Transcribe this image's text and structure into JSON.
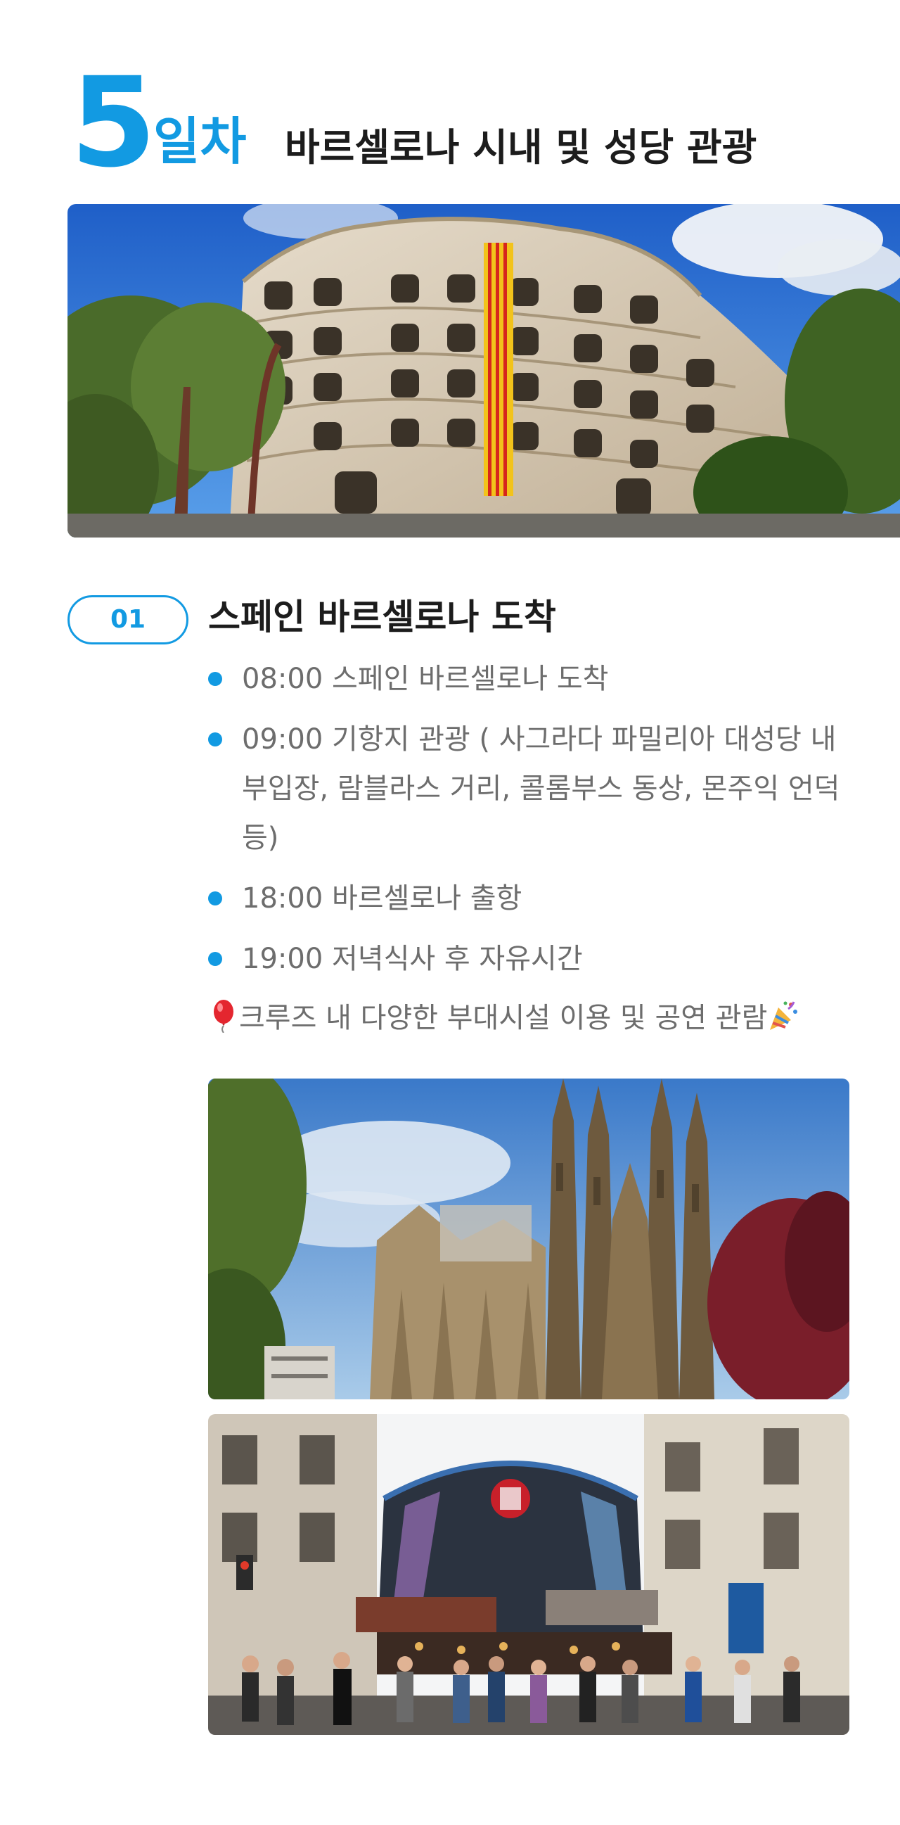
{
  "day": {
    "number": "5",
    "suffix": "일차",
    "title": "바르셀로나 시내 및 성당 관광"
  },
  "step": {
    "badge": "01",
    "title": "스페인 바르셀로나 도착",
    "items": [
      {
        "text": "08:00 스페인 바르셀로나 도착"
      },
      {
        "text": "09:00 기항지 관광 ( 사그라다 파밀리아 대성당 내부입장, 람블라스 거리, 콜롬부스 동상, 몬주익 언덕 등)"
      },
      {
        "text": "18:00 바르셀로나 출항"
      },
      {
        "text": "19:00 저녁식사 후 자유시간"
      }
    ],
    "note": "크루즈 내 다양한 부대시설 이용 및 공연 관람",
    "note_icons": [
      "balloon-icon",
      "party-popper-icon"
    ]
  },
  "colors": {
    "accent": "#129ae2",
    "heading": "#1c1c1c",
    "body_text": "#6d6d6d"
  }
}
